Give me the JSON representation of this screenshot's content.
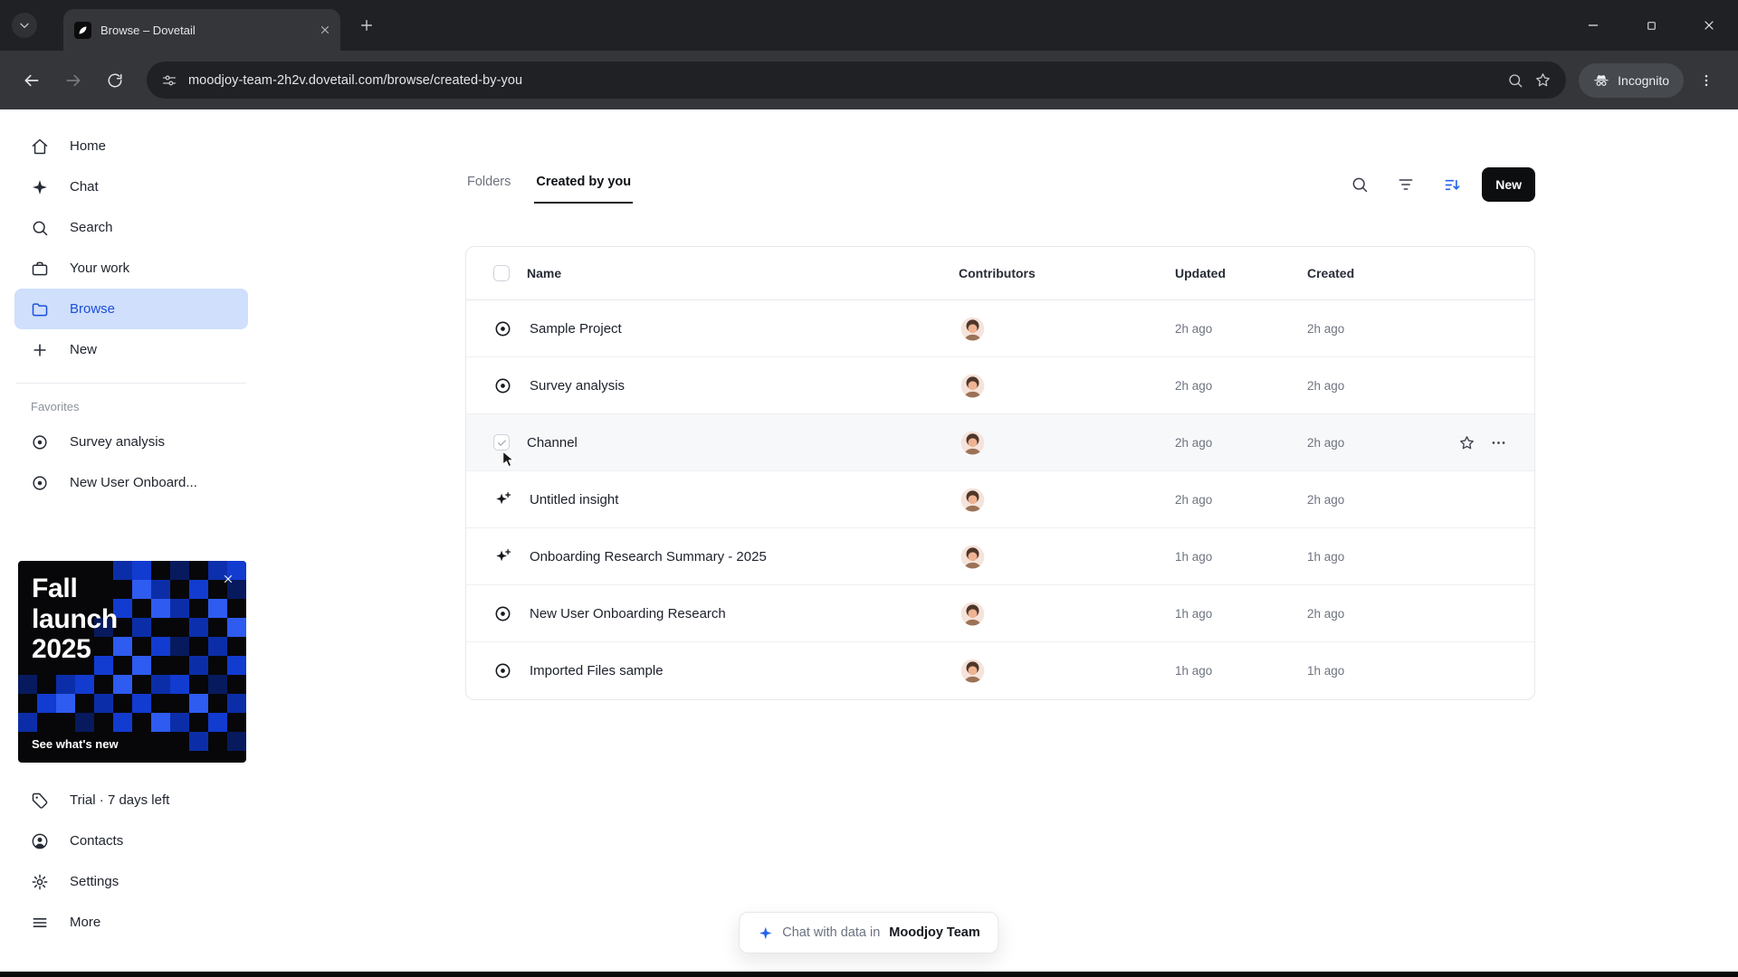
{
  "browser": {
    "tab_title": "Browse – Dovetail",
    "url": "moodjoy-team-2h2v.dovetail.com/browse/created-by-you",
    "incognito_label": "Incognito"
  },
  "sidebar": {
    "items": [
      {
        "label": "Home",
        "icon": "home-icon"
      },
      {
        "label": "Chat",
        "icon": "sparkle-icon"
      },
      {
        "label": "Search",
        "icon": "search-icon"
      },
      {
        "label": "Your work",
        "icon": "briefcase-icon"
      },
      {
        "label": "Browse",
        "icon": "folder-icon",
        "active": true
      },
      {
        "label": "New",
        "icon": "plus-icon"
      }
    ],
    "favorites_label": "Favorites",
    "favorites": [
      {
        "label": "Survey analysis",
        "icon": "project-icon"
      },
      {
        "label": "New User Onboard...",
        "icon": "project-icon"
      }
    ],
    "promo": {
      "title": "Fall launch 2025",
      "link": "See what's new"
    },
    "footer_items": [
      {
        "label": "Trial · 7 days left",
        "icon": "tag-icon"
      },
      {
        "label": "Contacts",
        "icon": "person-icon"
      },
      {
        "label": "Settings",
        "icon": "gear-icon"
      },
      {
        "label": "More",
        "icon": "menu-icon"
      }
    ]
  },
  "main": {
    "tabs": [
      {
        "label": "Folders",
        "active": false
      },
      {
        "label": "Created by you",
        "active": true
      }
    ],
    "actions": {
      "new_button": "New"
    },
    "table": {
      "columns": [
        "Name",
        "Contributors",
        "Updated",
        "Created"
      ],
      "rows": [
        {
          "name": "Sample Project",
          "icon": "project-icon",
          "updated": "2h ago",
          "created": "2h ago"
        },
        {
          "name": "Survey analysis",
          "icon": "project-icon",
          "updated": "2h ago",
          "created": "2h ago"
        },
        {
          "name": "Channel",
          "icon": "checkbox-hovered",
          "updated": "2h ago",
          "created": "2h ago",
          "hovered": true
        },
        {
          "name": "Untitled insight",
          "icon": "insight-icon",
          "updated": "2h ago",
          "created": "2h ago"
        },
        {
          "name": "Onboarding Research Summary - 2025",
          "icon": "insight-icon",
          "updated": "1h ago",
          "created": "1h ago"
        },
        {
          "name": "New User Onboarding Research",
          "icon": "project-icon",
          "updated": "1h ago",
          "created": "2h ago"
        },
        {
          "name": "Imported Files sample",
          "icon": "project-icon",
          "updated": "1h ago",
          "created": "1h ago"
        }
      ]
    },
    "chat_pill": {
      "prefix": "Chat with data in",
      "team": "Moodjoy Team"
    }
  },
  "colors": {
    "accent_blue": "#2563eb",
    "sidebar_active_bg": "#cfdffc",
    "sidebar_active_text": "#1c4fd8",
    "new_button_bg": "#0d0e10",
    "chrome_frame": "#202124",
    "chrome_toolbar": "#35363a",
    "promo_bg": "#070709"
  }
}
